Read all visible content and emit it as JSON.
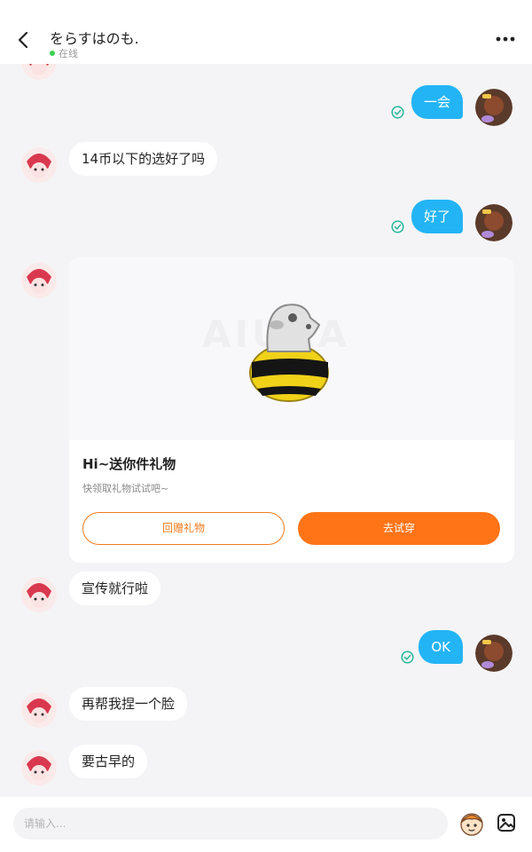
{
  "header": {
    "contact_name": "をらすはのも.",
    "status": "在线"
  },
  "messages": [
    {
      "direction": "out",
      "text": "一会",
      "read": true
    },
    {
      "direction": "in",
      "text": "14币以下的选好了吗"
    },
    {
      "direction": "out",
      "text": "好了",
      "read": true
    },
    {
      "direction": "in",
      "type": "gift-card"
    },
    {
      "direction": "in",
      "text": "宣传就行啦"
    },
    {
      "direction": "out",
      "text": "OK",
      "read": true
    },
    {
      "direction": "in",
      "text": "再帮我捏一个脸"
    },
    {
      "direction": "in",
      "text": "要古早的"
    }
  ],
  "gift_card": {
    "watermark": "AIURA",
    "title": "Hi~送你件礼物",
    "subtitle": "快领取礼物试试吧~",
    "return_gift_label": "回赠礼物",
    "try_on_label": "去试穿"
  },
  "composer": {
    "placeholder": "请输入..."
  },
  "colors": {
    "accent_blue": "#23b4f5",
    "accent_orange": "#ff7417",
    "online_green": "#3ccf4e",
    "read_check": "#1ab394"
  }
}
